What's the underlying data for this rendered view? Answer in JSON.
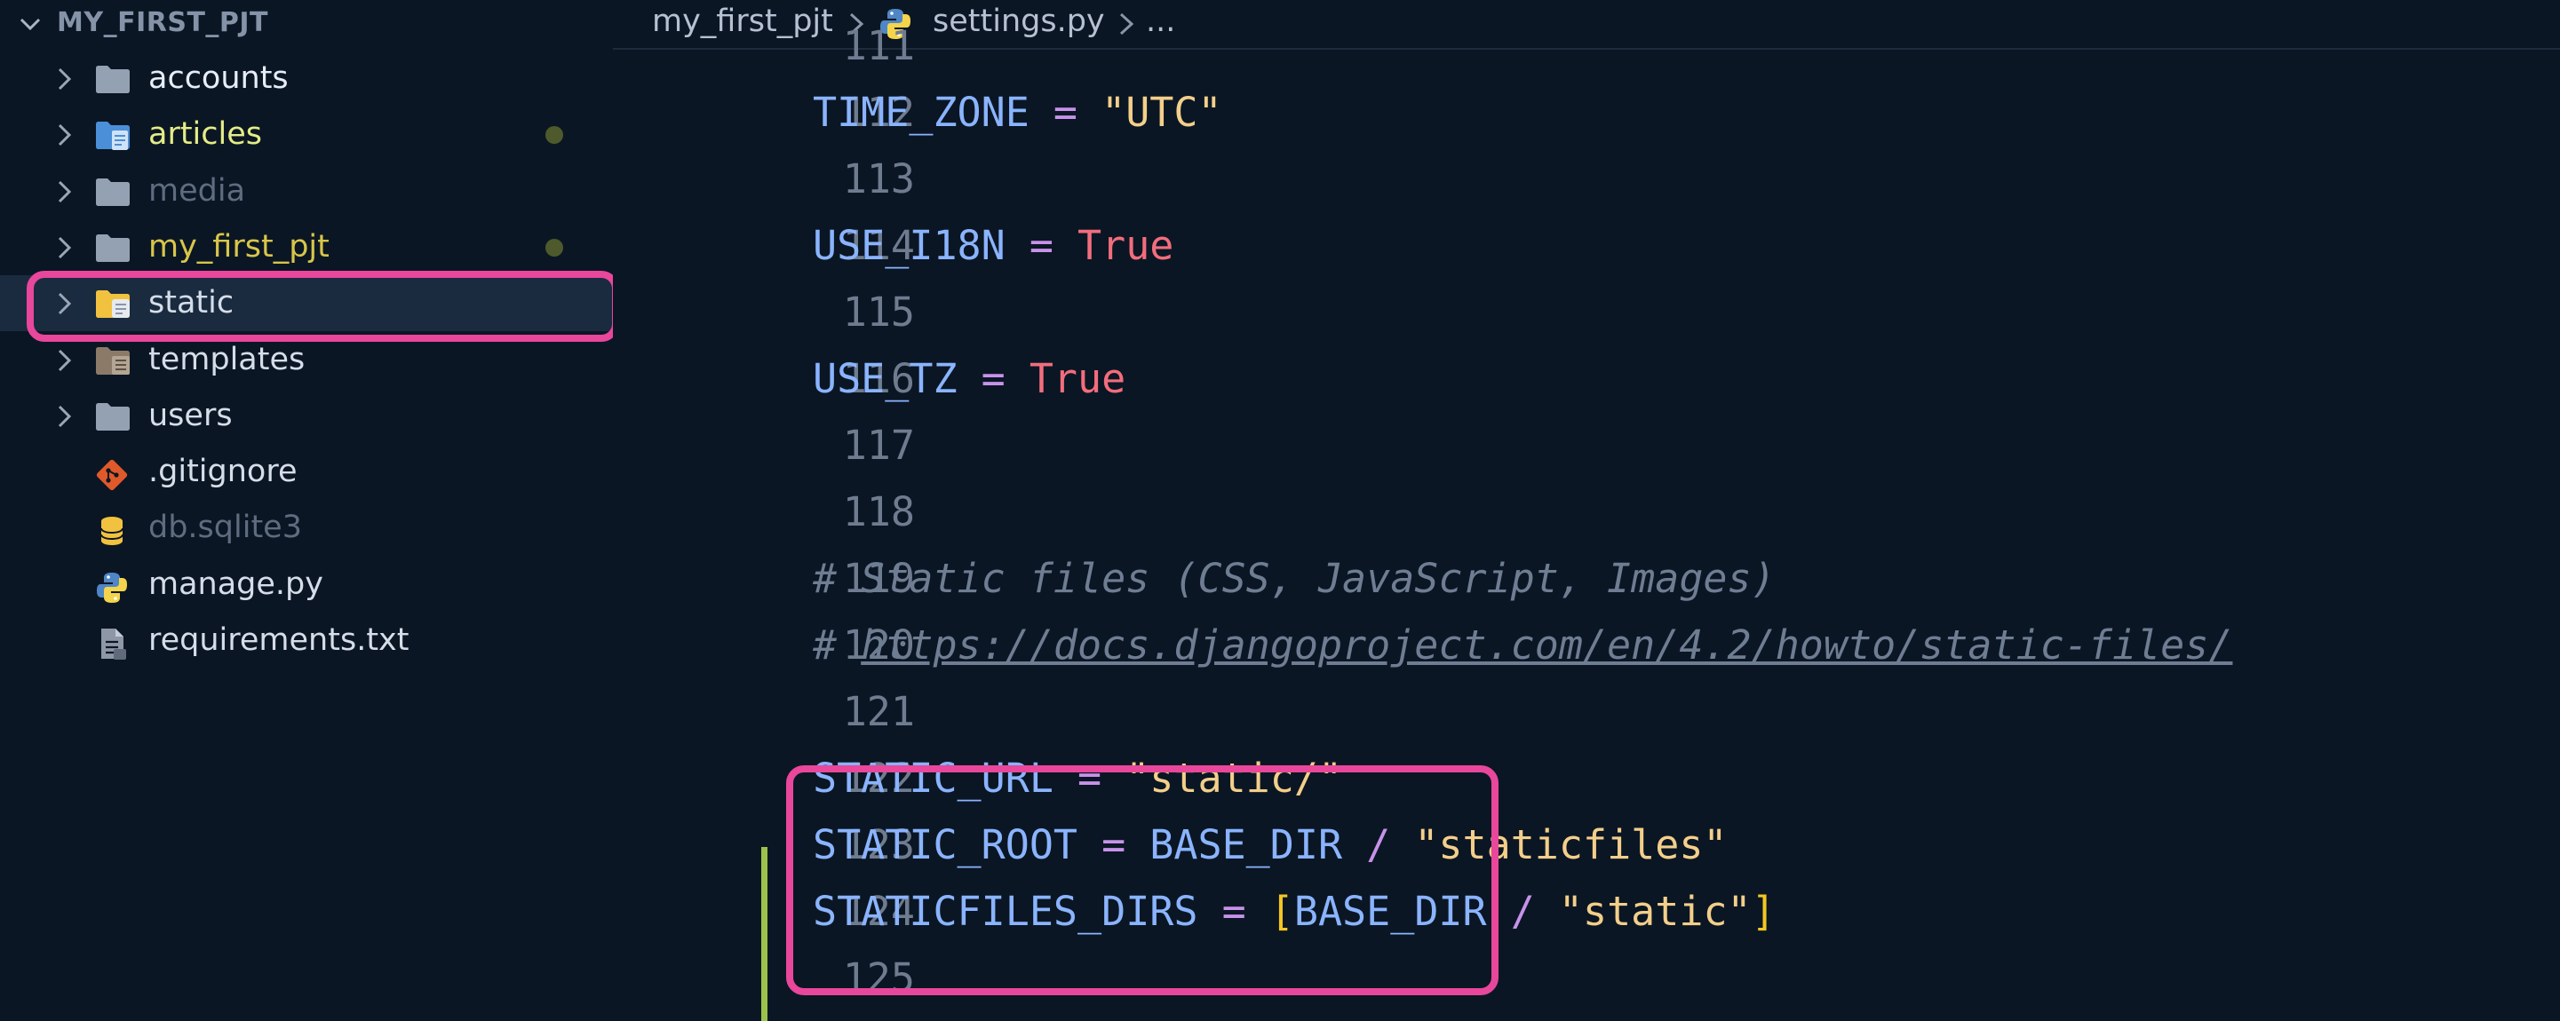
{
  "explorer": {
    "project_name": "MY_FIRST_PJT",
    "items": [
      {
        "name": "accounts",
        "kind": "folder",
        "color": "#e6edf7",
        "icon": "folder-icon",
        "modified": false
      },
      {
        "name": "articles",
        "kind": "folder",
        "color": "#e4ec86",
        "icon": "folder-doc-icon",
        "modified": true
      },
      {
        "name": "media",
        "kind": "folder",
        "color": "#5e6c80",
        "icon": "folder-icon",
        "modified": false
      },
      {
        "name": "my_first_pjt",
        "kind": "folder",
        "color": "#d8c64a",
        "icon": "folder-icon",
        "modified": true
      },
      {
        "name": "static",
        "kind": "folder",
        "color": "#d5dde9",
        "icon": "folder-static-icon",
        "modified": false,
        "selected": true
      },
      {
        "name": "templates",
        "kind": "folder",
        "color": "#d5dde9",
        "icon": "folder-templates-icon",
        "modified": false
      },
      {
        "name": "users",
        "kind": "folder",
        "color": "#d5dde9",
        "icon": "folder-icon",
        "modified": false
      },
      {
        "name": ".gitignore",
        "kind": "file",
        "color": "#d5dde9",
        "icon": "git-icon",
        "modified": false
      },
      {
        "name": "db.sqlite3",
        "kind": "file",
        "color": "#5e6c80",
        "icon": "database-icon",
        "modified": false
      },
      {
        "name": "manage.py",
        "kind": "file",
        "color": "#d5dde9",
        "icon": "python-icon",
        "modified": false
      },
      {
        "name": "requirements.txt",
        "kind": "file",
        "color": "#d5dde9",
        "icon": "text-file-icon",
        "modified": false
      }
    ]
  },
  "breadcrumb": {
    "folder": "my_first_pjt",
    "file": "settings.py",
    "more": "..."
  },
  "code": {
    "lines": [
      {
        "n": "111",
        "tokens": []
      },
      {
        "n": "112",
        "tokens": [
          [
            "var",
            "TIME_ZONE"
          ],
          [
            "op",
            " = "
          ],
          [
            "str",
            "\"UTC\""
          ]
        ]
      },
      {
        "n": "113",
        "tokens": []
      },
      {
        "n": "114",
        "tokens": [
          [
            "var",
            "USE_I18N"
          ],
          [
            "op",
            " = "
          ],
          [
            "kw",
            "True"
          ]
        ]
      },
      {
        "n": "115",
        "tokens": []
      },
      {
        "n": "116",
        "tokens": [
          [
            "var",
            "USE_TZ"
          ],
          [
            "op",
            " = "
          ],
          [
            "kw",
            "True"
          ]
        ]
      },
      {
        "n": "117",
        "tokens": []
      },
      {
        "n": "118",
        "tokens": []
      },
      {
        "n": "119",
        "tokens": [
          [
            "cm",
            "# Static files (CSS, JavaScript, Images)"
          ]
        ]
      },
      {
        "n": "120",
        "tokens": [
          [
            "cm",
            "# "
          ],
          [
            "url",
            "https://docs.djangoproject.com/en/4.2/howto/static-files/"
          ]
        ]
      },
      {
        "n": "121",
        "tokens": []
      },
      {
        "n": "122",
        "tokens": [
          [
            "var",
            "STATIC_URL"
          ],
          [
            "op",
            " = "
          ],
          [
            "str",
            "\"static/\""
          ]
        ]
      },
      {
        "n": "123",
        "tokens": [
          [
            "var",
            "STATIC_ROOT"
          ],
          [
            "op",
            " = "
          ],
          [
            "var",
            "BASE_DIR"
          ],
          [
            "op",
            " / "
          ],
          [
            "str",
            "\"staticfiles\""
          ]
        ]
      },
      {
        "n": "124",
        "tokens": [
          [
            "var",
            "STATICFILES_DIRS"
          ],
          [
            "op",
            " = "
          ],
          [
            "br",
            "["
          ],
          [
            "var",
            "BASE_DIR"
          ],
          [
            "op",
            " / "
          ],
          [
            "str",
            "\"static\""
          ],
          [
            "br",
            "]"
          ]
        ]
      },
      {
        "n": "125",
        "tokens": []
      }
    ]
  },
  "colors": {
    "background": "#0b1624",
    "highlight": "#e8479b",
    "selection": "#1a2b40",
    "modified_bar": "#9bc24a"
  }
}
